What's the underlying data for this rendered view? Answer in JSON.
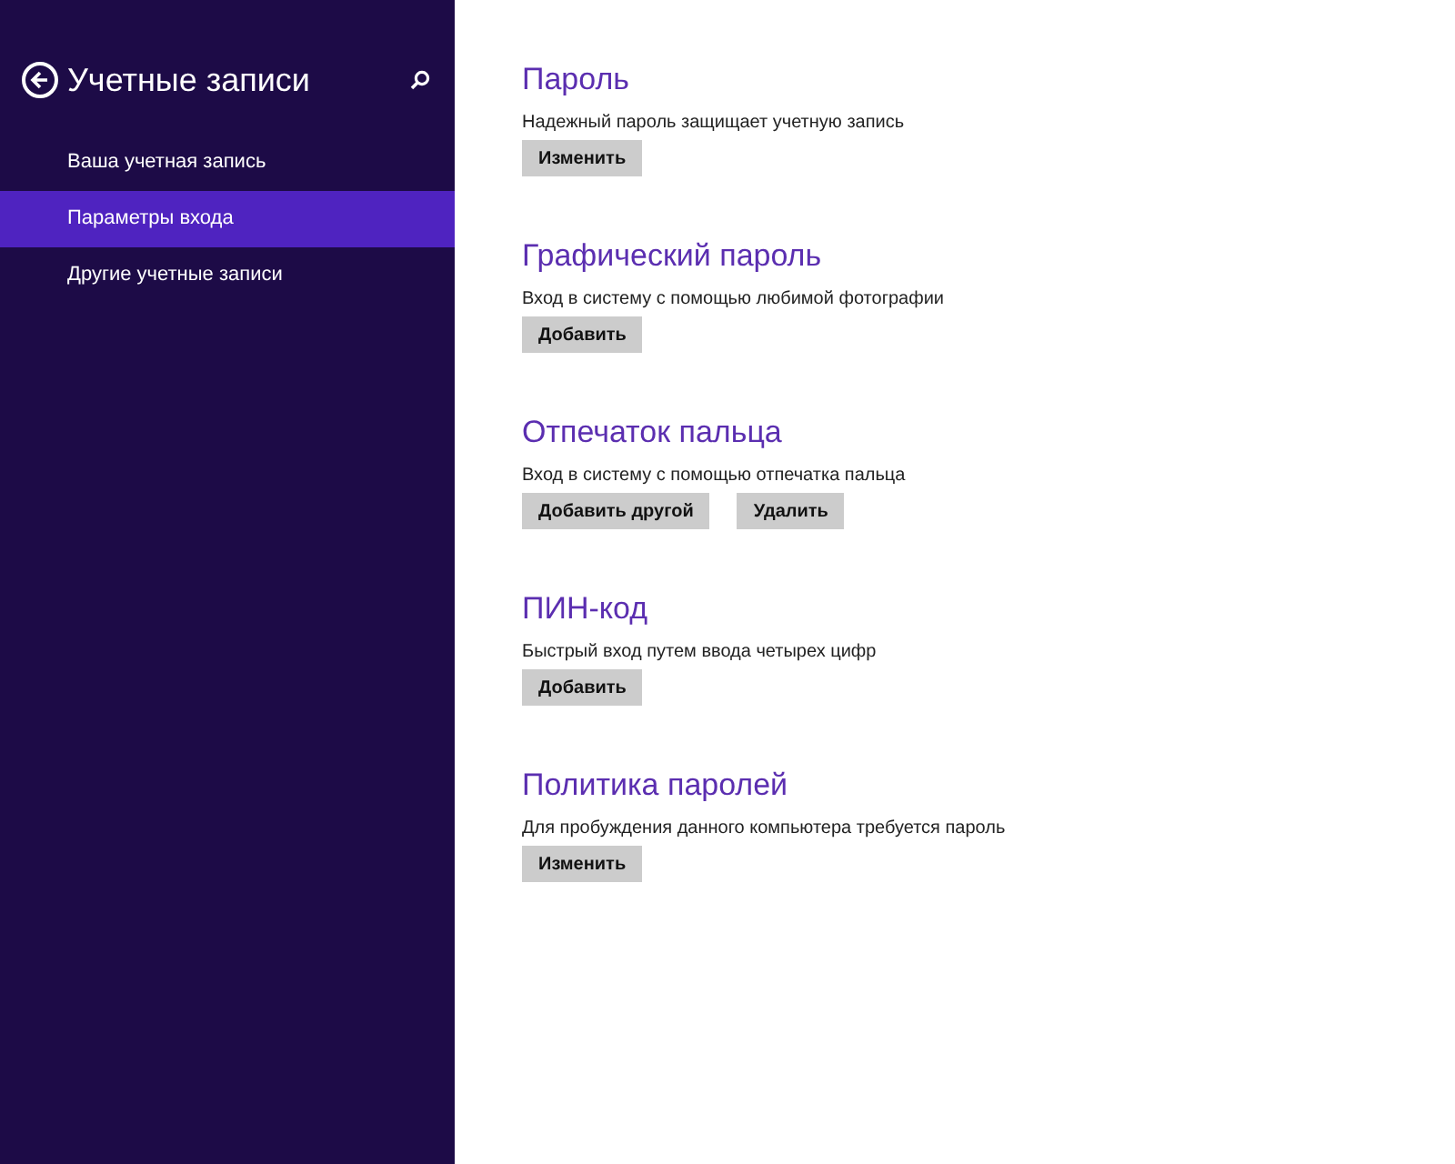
{
  "sidebar": {
    "title": "Учетные записи",
    "items": [
      {
        "label": "Ваша учетная запись",
        "selected": false
      },
      {
        "label": "Параметры входа",
        "selected": true
      },
      {
        "label": "Другие учетные записи",
        "selected": false
      }
    ]
  },
  "sections": [
    {
      "heading": "Пароль",
      "description": "Надежный пароль защищает учетную запись",
      "buttons": [
        "Изменить"
      ]
    },
    {
      "heading": "Графический пароль",
      "description": "Вход в систему с помощью любимой фотографии",
      "buttons": [
        "Добавить"
      ]
    },
    {
      "heading": "Отпечаток пальца",
      "description": "Вход в систему с помощью отпечатка пальца",
      "buttons": [
        "Добавить другой",
        "Удалить"
      ]
    },
    {
      "heading": "ПИН-код",
      "description": "Быстрый вход путем ввода четырех цифр",
      "buttons": [
        "Добавить"
      ]
    },
    {
      "heading": "Политика паролей",
      "description": "Для пробуждения данного компьютера требуется пароль",
      "buttons": [
        "Изменить"
      ]
    }
  ]
}
